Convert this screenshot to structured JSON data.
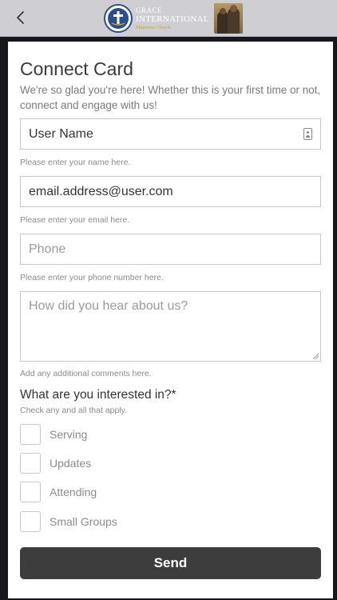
{
  "header": {
    "logo_line1": "GRACE",
    "logo_line2": "INTERNATIONAL",
    "logo_line3": "Ministries Church",
    "logo_color": "#c9a227"
  },
  "form": {
    "title": "Connect Card",
    "subtitle": "We're so glad you're here! Whether this is your first time or not, connect and engage with us!",
    "name": {
      "value": "User Name",
      "help": "Please enter your name here."
    },
    "email": {
      "value": "email.address@user.com",
      "help": "Please enter your email here."
    },
    "phone": {
      "placeholder": "Phone",
      "help": "Please enter your phone number here."
    },
    "comments": {
      "placeholder": "How did you hear about us?",
      "help": "Add any additional comments here."
    },
    "interests": {
      "question": "What are you interested in?*",
      "hint": "Check any and all that apply.",
      "options": [
        {
          "label": "Serving",
          "checked": false
        },
        {
          "label": "Updates",
          "checked": false
        },
        {
          "label": "Attending",
          "checked": false
        },
        {
          "label": "Small Groups",
          "checked": false
        }
      ]
    },
    "send_label": "Send"
  },
  "colors": {
    "header_bg": "#cfcfd3",
    "page_bg": "#16161c",
    "button_bg": "#3d3d3d"
  }
}
